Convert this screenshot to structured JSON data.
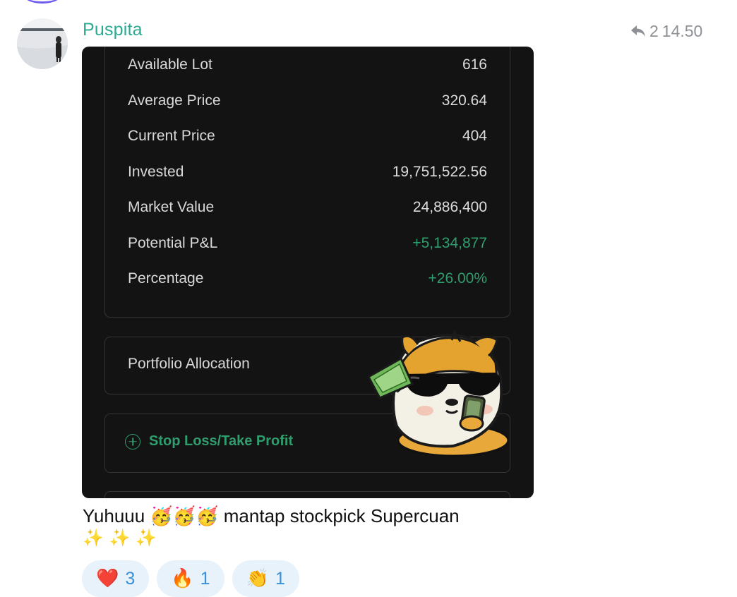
{
  "message": {
    "sender": "Puspita",
    "reply_count": "2",
    "time": "14.50",
    "caption_text": "Yuhuuu 🥳🥳🥳 mantap stockpick Supercuan",
    "caption_sparkles": "✨ ✨ ✨"
  },
  "photo": {
    "rows": [
      {
        "label": "Available Lot",
        "value": "616"
      },
      {
        "label": "Average Price",
        "value": "320.64"
      },
      {
        "label": "Current Price",
        "value": "404"
      },
      {
        "label": "Invested",
        "value": "19,751,522.56"
      },
      {
        "label": "Market Value",
        "value": "24,886,400"
      },
      {
        "label": "Potential P&L",
        "value": "+5,134,877"
      },
      {
        "label": "Percentage",
        "value": "+26.00%"
      }
    ],
    "allocation_label": "Portfolio Allocation",
    "sltp_label": "Stop Loss/Take Profit",
    "positive_color": "#2f9d6d"
  },
  "reactions": [
    {
      "emoji": "❤️",
      "count": "3"
    },
    {
      "emoji": "🔥",
      "count": "1"
    },
    {
      "emoji": "👏",
      "count": "1"
    }
  ],
  "icons": {
    "reply": "reply-arrow-icon",
    "avatar": "avatar",
    "sticker": "hamster-sticker"
  }
}
